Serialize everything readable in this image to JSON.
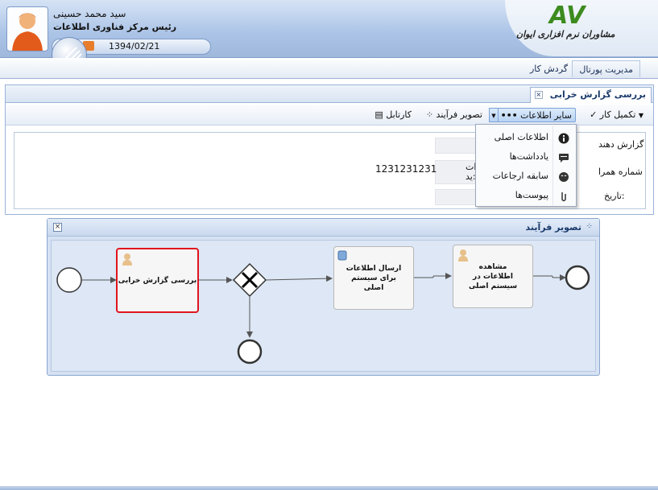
{
  "header": {
    "user_name": "سید محمد حسینی",
    "user_title": "رئیس مرکز فناوری اطلاعات",
    "date": "1394/02/21",
    "logo_text": "مشاوران نرم افزاری ایوان",
    "logo_mark": "AV"
  },
  "nav": {
    "items": [
      {
        "label": "مدیریت پورتال"
      },
      {
        "label": "گردش کار"
      }
    ]
  },
  "tab": {
    "title": "بررسی گزارش خرابی"
  },
  "toolbar": {
    "complete": "تکمیل کار",
    "other_info": "سایر اطلاعات",
    "process_image": "تصویر فرآیند",
    "cardboard": "کارتابل"
  },
  "form": {
    "reporter_label": "گزارش دهند",
    "phone_label": "شماره همرا",
    "date_label": "تاریخ:",
    "phone_value": "1231231231",
    "desc_fragment_1": "ات",
    "desc_fragment_2": "ید:"
  },
  "menu": {
    "items": [
      {
        "label": "اطلاعات اصلی",
        "icon": "info-icon"
      },
      {
        "label": "یادداشت‌ها",
        "icon": "notes-icon"
      },
      {
        "label": "سابقه ارجاعات",
        "icon": "history-icon"
      },
      {
        "label": "پیوست‌ها",
        "icon": "paperclip-icon"
      }
    ]
  },
  "process_window": {
    "title": "تصویر فرآیند",
    "tasks": {
      "review": "بررسی گزارش خرابی",
      "send": "ارسال اطلاعات برای سیستم اصلی",
      "view": "مشاهده اطلاعات در سیستم اصلی"
    }
  },
  "colors": {
    "active_task_border": "#e0141e",
    "header_blue": "#aac3e6"
  }
}
